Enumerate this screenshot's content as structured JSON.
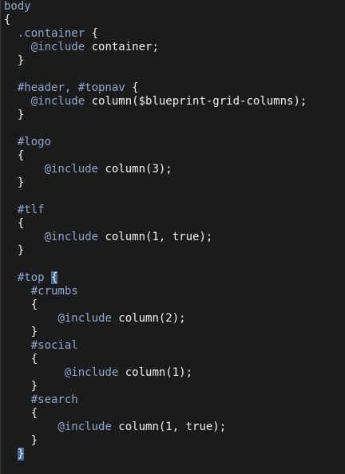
{
  "editor": {
    "lines": [
      {
        "text": "body",
        "kind": "selector"
      },
      {
        "text": "{",
        "kind": "brace"
      },
      {
        "text": "  .container {",
        "kind": "selector"
      },
      {
        "text": "    @include container;",
        "kind": "directive"
      },
      {
        "text": "  }",
        "kind": "brace"
      },
      {
        "text": "",
        "kind": "blank"
      },
      {
        "text": "  #header, #topnav {",
        "kind": "selector"
      },
      {
        "text": "    @include column($blueprint-grid-columns);",
        "kind": "directive"
      },
      {
        "text": "  }",
        "kind": "brace"
      },
      {
        "text": "",
        "kind": "blank"
      },
      {
        "text": "  #logo",
        "kind": "selector"
      },
      {
        "text": "  {",
        "kind": "brace"
      },
      {
        "text": "      @include column(3);",
        "kind": "directive"
      },
      {
        "text": "  }",
        "kind": "brace"
      },
      {
        "text": "",
        "kind": "blank"
      },
      {
        "text": "  #tlf",
        "kind": "selector"
      },
      {
        "text": "  {",
        "kind": "brace"
      },
      {
        "text": "      @include column(1, true);",
        "kind": "directive"
      },
      {
        "text": "  }",
        "kind": "brace"
      },
      {
        "text": "",
        "kind": "blank"
      },
      {
        "text": "  #top {",
        "kind": "selector-hl"
      },
      {
        "text": "    #crumbs",
        "kind": "selector"
      },
      {
        "text": "    {",
        "kind": "brace"
      },
      {
        "text": "        @include column(2);",
        "kind": "directive"
      },
      {
        "text": "    }",
        "kind": "brace"
      },
      {
        "text": "    #social",
        "kind": "selector"
      },
      {
        "text": "    {",
        "kind": "brace"
      },
      {
        "text": "         @include column(1);",
        "kind": "directive"
      },
      {
        "text": "    }",
        "kind": "brace"
      },
      {
        "text": "    #search",
        "kind": "selector"
      },
      {
        "text": "    {",
        "kind": "brace"
      },
      {
        "text": "        @include column(1, true);",
        "kind": "directive"
      },
      {
        "text": "    }",
        "kind": "brace"
      },
      {
        "text": "  }",
        "kind": "brace-cursor"
      }
    ],
    "colors": {
      "background": "#1b1b1b",
      "keyword": "#8fa6cf",
      "text": "#f0f0f0",
      "bracket_highlight": "#4a6a9a"
    }
  }
}
